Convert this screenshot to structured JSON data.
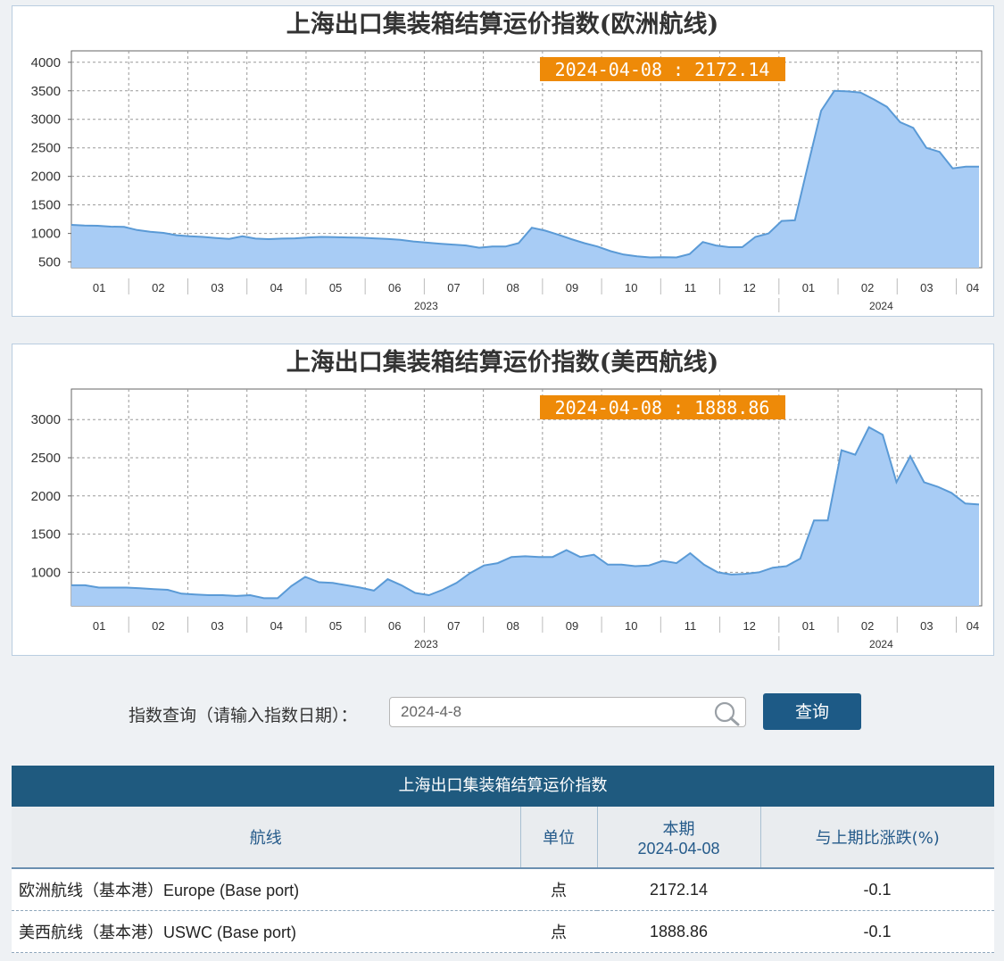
{
  "chart_data": [
    {
      "type": "area",
      "title": "上海出口集装箱结算运价指数(欧洲航线)",
      "tooltip": "2024-04-08 : 2172.14",
      "ylim": [
        400,
        4200
      ],
      "yticks": [
        500,
        1000,
        1500,
        2000,
        2500,
        3000,
        3500,
        4000
      ],
      "x_months": [
        "01",
        "02",
        "03",
        "04",
        "05",
        "06",
        "07",
        "08",
        "09",
        "10",
        "11",
        "12",
        "01",
        "02",
        "03",
        "04"
      ],
      "x_years": [
        "2023",
        "2024"
      ],
      "fill_color": "#a8ccf5",
      "line_color": "#5a9ad6",
      "grid": true,
      "x": [
        0,
        1,
        2,
        3,
        4,
        5,
        6,
        7,
        8,
        9,
        10,
        11,
        12,
        13,
        14,
        15,
        16,
        17,
        18,
        19,
        20,
        21,
        22,
        23,
        24,
        25,
        26,
        27,
        28,
        29,
        30,
        31,
        32,
        33,
        34,
        35,
        36,
        37,
        38,
        39,
        40,
        41,
        42,
        43,
        44,
        45,
        46,
        47,
        48,
        49,
        50,
        51,
        52,
        53,
        54,
        55,
        56,
        57,
        58,
        59,
        60,
        61,
        62,
        63,
        64,
        65
      ],
      "values": [
        1150,
        1140,
        1135,
        1120,
        1115,
        1060,
        1030,
        1010,
        970,
        950,
        940,
        920,
        905,
        950,
        910,
        900,
        910,
        915,
        930,
        940,
        935,
        930,
        925,
        915,
        905,
        890,
        860,
        840,
        820,
        805,
        790,
        750,
        770,
        770,
        830,
        1100,
        1050,
        980,
        900,
        830,
        770,
        690,
        630,
        600,
        580,
        585,
        580,
        640,
        850,
        790,
        760,
        760,
        940,
        1000,
        1220,
        1230,
        2200,
        3150,
        3500,
        3490,
        3470,
        3350,
        3220,
        2950,
        2850,
        2500,
        2430,
        2140,
        2170,
        2172
      ],
      "series_name": ""
    },
    {
      "type": "area",
      "title": "上海出口集装箱结算运价指数(美西航线)",
      "tooltip": "2024-04-08 : 1888.86",
      "ylim": [
        560,
        3400
      ],
      "yticks": [
        1000,
        1500,
        2000,
        2500,
        3000
      ],
      "x_months": [
        "01",
        "02",
        "03",
        "04",
        "05",
        "06",
        "07",
        "08",
        "09",
        "10",
        "11",
        "12",
        "01",
        "02",
        "03",
        "04"
      ],
      "x_years": [
        "2023",
        "2024"
      ],
      "fill_color": "#a8ccf5",
      "line_color": "#5a9ad6",
      "grid": true,
      "values": [
        830,
        830,
        800,
        800,
        800,
        790,
        780,
        770,
        720,
        710,
        700,
        700,
        690,
        700,
        660,
        660,
        820,
        940,
        870,
        860,
        830,
        800,
        760,
        910,
        830,
        730,
        700,
        770,
        860,
        990,
        1090,
        1120,
        1200,
        1210,
        1200,
        1200,
        1290,
        1200,
        1230,
        1100,
        1100,
        1080,
        1090,
        1150,
        1120,
        1250,
        1100,
        1000,
        970,
        980,
        1000,
        1060,
        1080,
        1180,
        1680,
        1680,
        2600,
        2540,
        2900,
        2800,
        2180,
        2520,
        2180,
        2120,
        2040,
        1900,
        1888
      ],
      "series_name": ""
    }
  ],
  "query": {
    "label": "指数查询（请输入指数日期）：",
    "value": "2024-4-8",
    "button": "查询"
  },
  "table": {
    "title": "上海出口集装箱结算运价指数",
    "headers": {
      "route": "航线",
      "unit": "单位",
      "current_label": "本期",
      "current_date": "2024-04-08",
      "change": "与上期比涨跌(%)"
    },
    "rows": [
      {
        "route": "欧洲航线（基本港）Europe (Base port)",
        "unit": "点",
        "value": "2172.14",
        "change": "-0.1"
      },
      {
        "route": "美西航线（基本港）USWC (Base port)",
        "unit": "点",
        "value": "1888.86",
        "change": "-0.1"
      }
    ]
  }
}
